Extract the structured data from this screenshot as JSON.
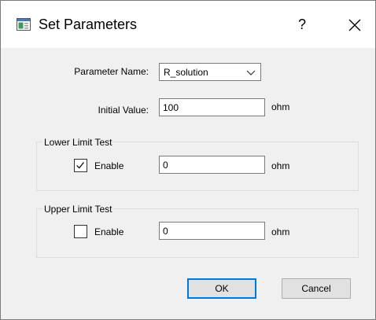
{
  "window": {
    "title": "Set Parameters",
    "help_label": "?",
    "icon": "dialog-app-icon",
    "close_icon": "close-icon"
  },
  "form": {
    "parameter_name_label": "Parameter Name:",
    "parameter_name_value": "R_solution",
    "initial_value_label": "Initial Value:",
    "initial_value": "100",
    "initial_value_unit": "ohm"
  },
  "lower_limit": {
    "group_title": "Lower Limit Test",
    "enable_label": "Enable",
    "enabled": true,
    "value": "0",
    "unit": "ohm"
  },
  "upper_limit": {
    "group_title": "Upper Limit Test",
    "enable_label": "Enable",
    "enabled": false,
    "value": "0",
    "unit": "ohm"
  },
  "buttons": {
    "ok_label": "OK",
    "cancel_label": "Cancel"
  },
  "colors": {
    "accent": "#0078d7",
    "dialog_background": "#f0f0f0",
    "titlebar_background": "#ffffff"
  }
}
